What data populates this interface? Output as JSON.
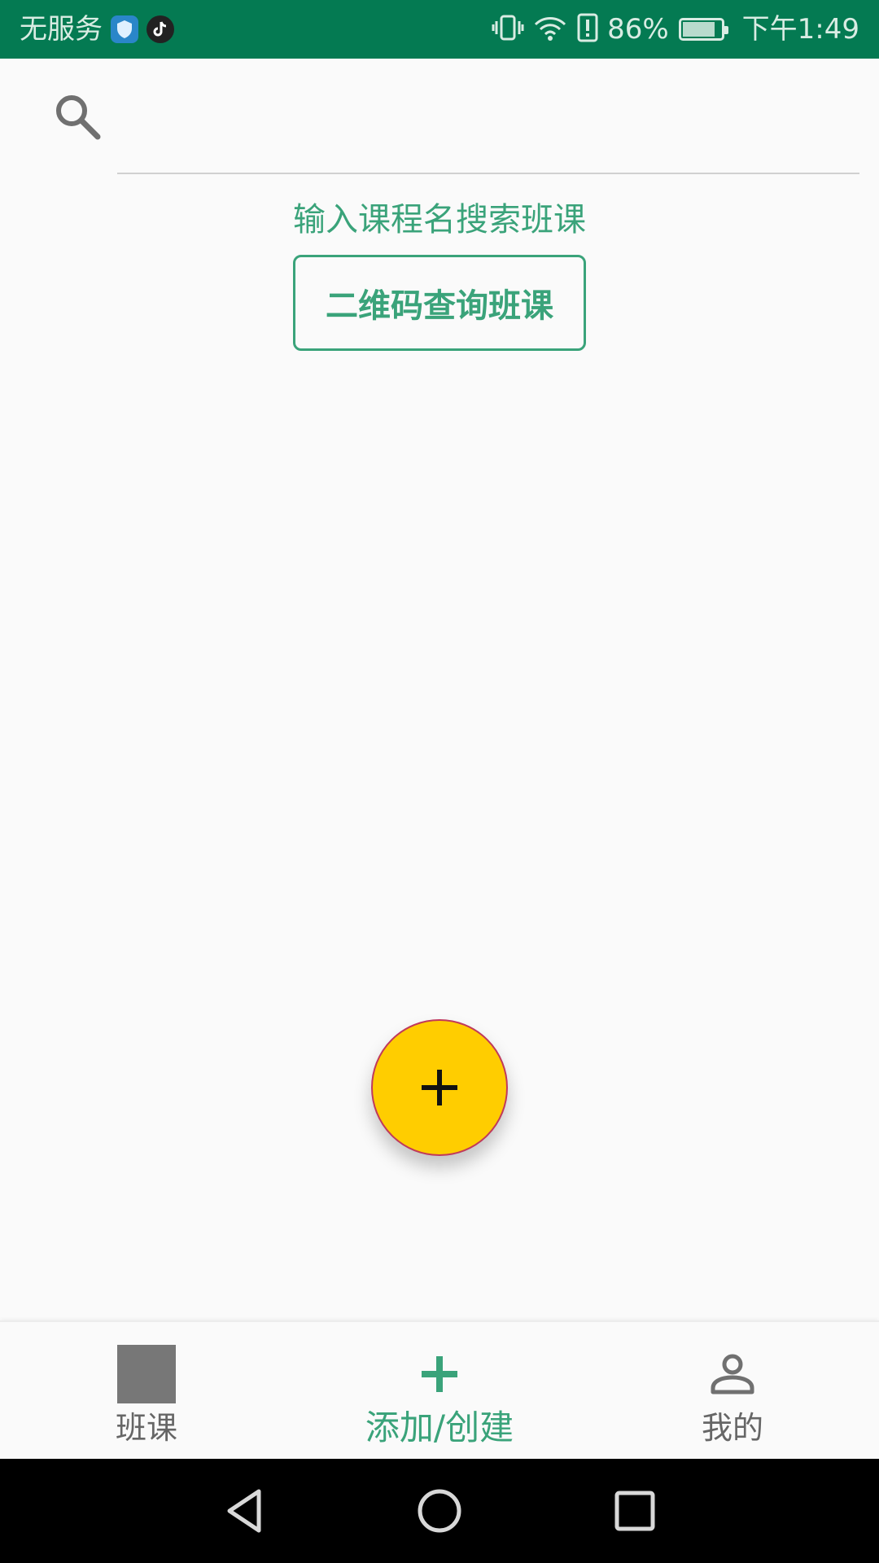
{
  "status_bar": {
    "carrier": "无服务",
    "battery_percent_text": "86%",
    "battery_level": 0.86,
    "time": "下午1:49",
    "icons": [
      "shield-app-icon",
      "tiktok-app-icon",
      "vibrate-icon",
      "wifi-icon",
      "alert-icon",
      "battery-icon"
    ]
  },
  "search": {
    "icon": "search-icon",
    "hint": "输入课程名搜索班课"
  },
  "qr_button": {
    "label": "二维码查询班课"
  },
  "fab": {
    "icon": "plus-icon",
    "color": "#ffcd00"
  },
  "bottom_nav": {
    "items": [
      {
        "label": "班课",
        "icon": "square-icon",
        "active": false
      },
      {
        "label": "添加/创建",
        "icon": "plus-icon",
        "active": true
      },
      {
        "label": "我的",
        "icon": "person-icon",
        "active": false
      }
    ]
  },
  "system_nav": {
    "icons": [
      "back-icon",
      "home-icon",
      "recents-icon"
    ]
  },
  "colors": {
    "status_bar": "#047a52",
    "accent": "#3aa37a",
    "fab": "#ffcd00",
    "fab_border": "#c0395b"
  }
}
